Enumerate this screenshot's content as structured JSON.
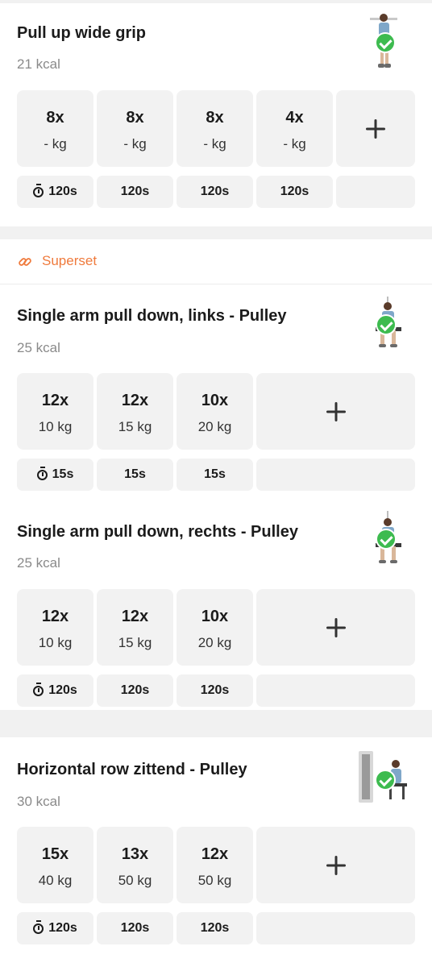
{
  "colors": {
    "accent": "#ef7a3c",
    "check": "#3dbb4f",
    "tile": "#f2f2f2",
    "background": "#f1f1f1"
  },
  "superset": {
    "label": "Superset",
    "icon": "link-icon"
  },
  "exercises": [
    {
      "title": "Pull up wide grip",
      "kcal": "21 kcal",
      "completed": true,
      "sets": [
        {
          "reps": "8x",
          "weight": "- kg"
        },
        {
          "reps": "8x",
          "weight": "- kg"
        },
        {
          "reps": "8x",
          "weight": "- kg"
        },
        {
          "reps": "4x",
          "weight": "- kg"
        }
      ],
      "rests": [
        "120s",
        "120s",
        "120s",
        "120s"
      ]
    },
    {
      "title": "Single arm pull down, links - Pulley",
      "kcal": "25 kcal",
      "completed": true,
      "sets": [
        {
          "reps": "12x",
          "weight": "10 kg"
        },
        {
          "reps": "12x",
          "weight": "15 kg"
        },
        {
          "reps": "10x",
          "weight": "20 kg"
        }
      ],
      "rests": [
        "15s",
        "15s",
        "15s"
      ]
    },
    {
      "title": "Single arm pull down, rechts - Pulley",
      "kcal": "25 kcal",
      "completed": true,
      "sets": [
        {
          "reps": "12x",
          "weight": "10 kg"
        },
        {
          "reps": "12x",
          "weight": "15 kg"
        },
        {
          "reps": "10x",
          "weight": "20 kg"
        }
      ],
      "rests": [
        "120s",
        "120s",
        "120s"
      ]
    },
    {
      "title": "Horizontal row zittend - Pulley",
      "kcal": "30 kcal",
      "completed": true,
      "sets": [
        {
          "reps": "15x",
          "weight": "40 kg"
        },
        {
          "reps": "13x",
          "weight": "50 kg"
        },
        {
          "reps": "12x",
          "weight": "50 kg"
        }
      ],
      "rests": [
        "120s",
        "120s",
        "120s"
      ]
    }
  ]
}
